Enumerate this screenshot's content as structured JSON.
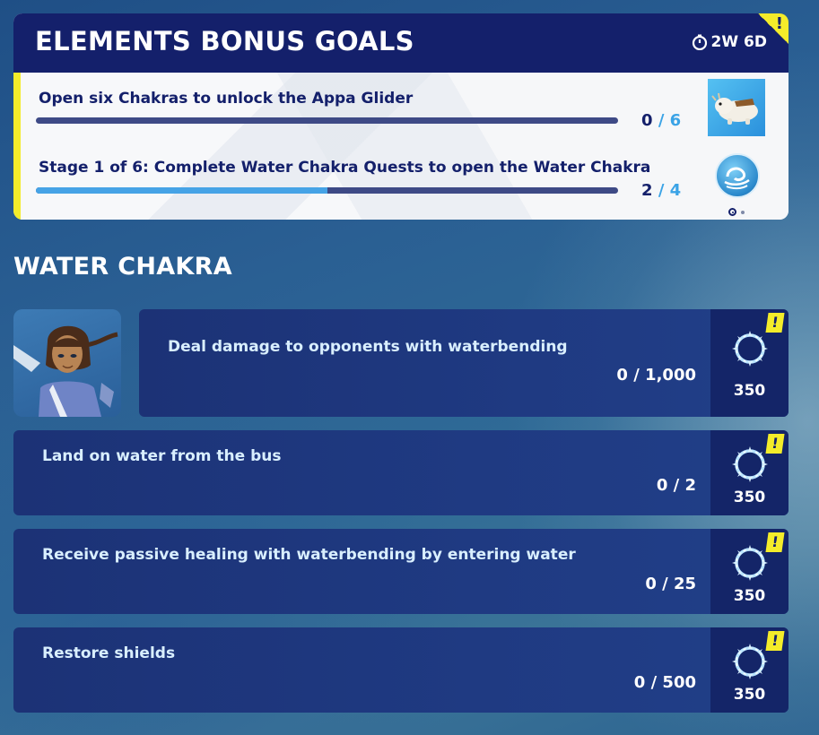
{
  "bonus_goals": {
    "title": "ELEMENTS BONUS GOALS",
    "timer": "2W 6D",
    "alert_mark": "!",
    "goals": [
      {
        "title": "Open six Chakras to unlock the Appa Glider",
        "progress": "0",
        "total": "/ 6",
        "fill_fraction": 0.0,
        "icon": "appa-glider-icon"
      },
      {
        "title": "Stage 1 of 6: Complete Water Chakra Quests to open the Water Chakra",
        "progress": "2",
        "total": "/ 4",
        "fill_fraction": 0.5,
        "icon": "water-chakra-emblem-icon"
      }
    ]
  },
  "water_chakra": {
    "title": "WATER CHAKRA",
    "quests": [
      {
        "text": "Deal damage to opponents with waterbending",
        "progress": "0 / 1,000",
        "reward": "350",
        "alert": "!"
      },
      {
        "text": "Land on water from the bus",
        "progress": "0 / 2",
        "reward": "350",
        "alert": "!"
      },
      {
        "text": "Receive passive healing with waterbending by entering water",
        "progress": "0 / 25",
        "reward": "350",
        "alert": "!"
      },
      {
        "text": "Restore shields",
        "progress": "0 / 500",
        "reward": "350",
        "alert": "!"
      }
    ]
  },
  "colors": {
    "header_navy": "#14206b",
    "accent_yellow": "#f4ec2a",
    "progress_blue": "#46a3e6",
    "card_blue": "#1f3a82"
  }
}
